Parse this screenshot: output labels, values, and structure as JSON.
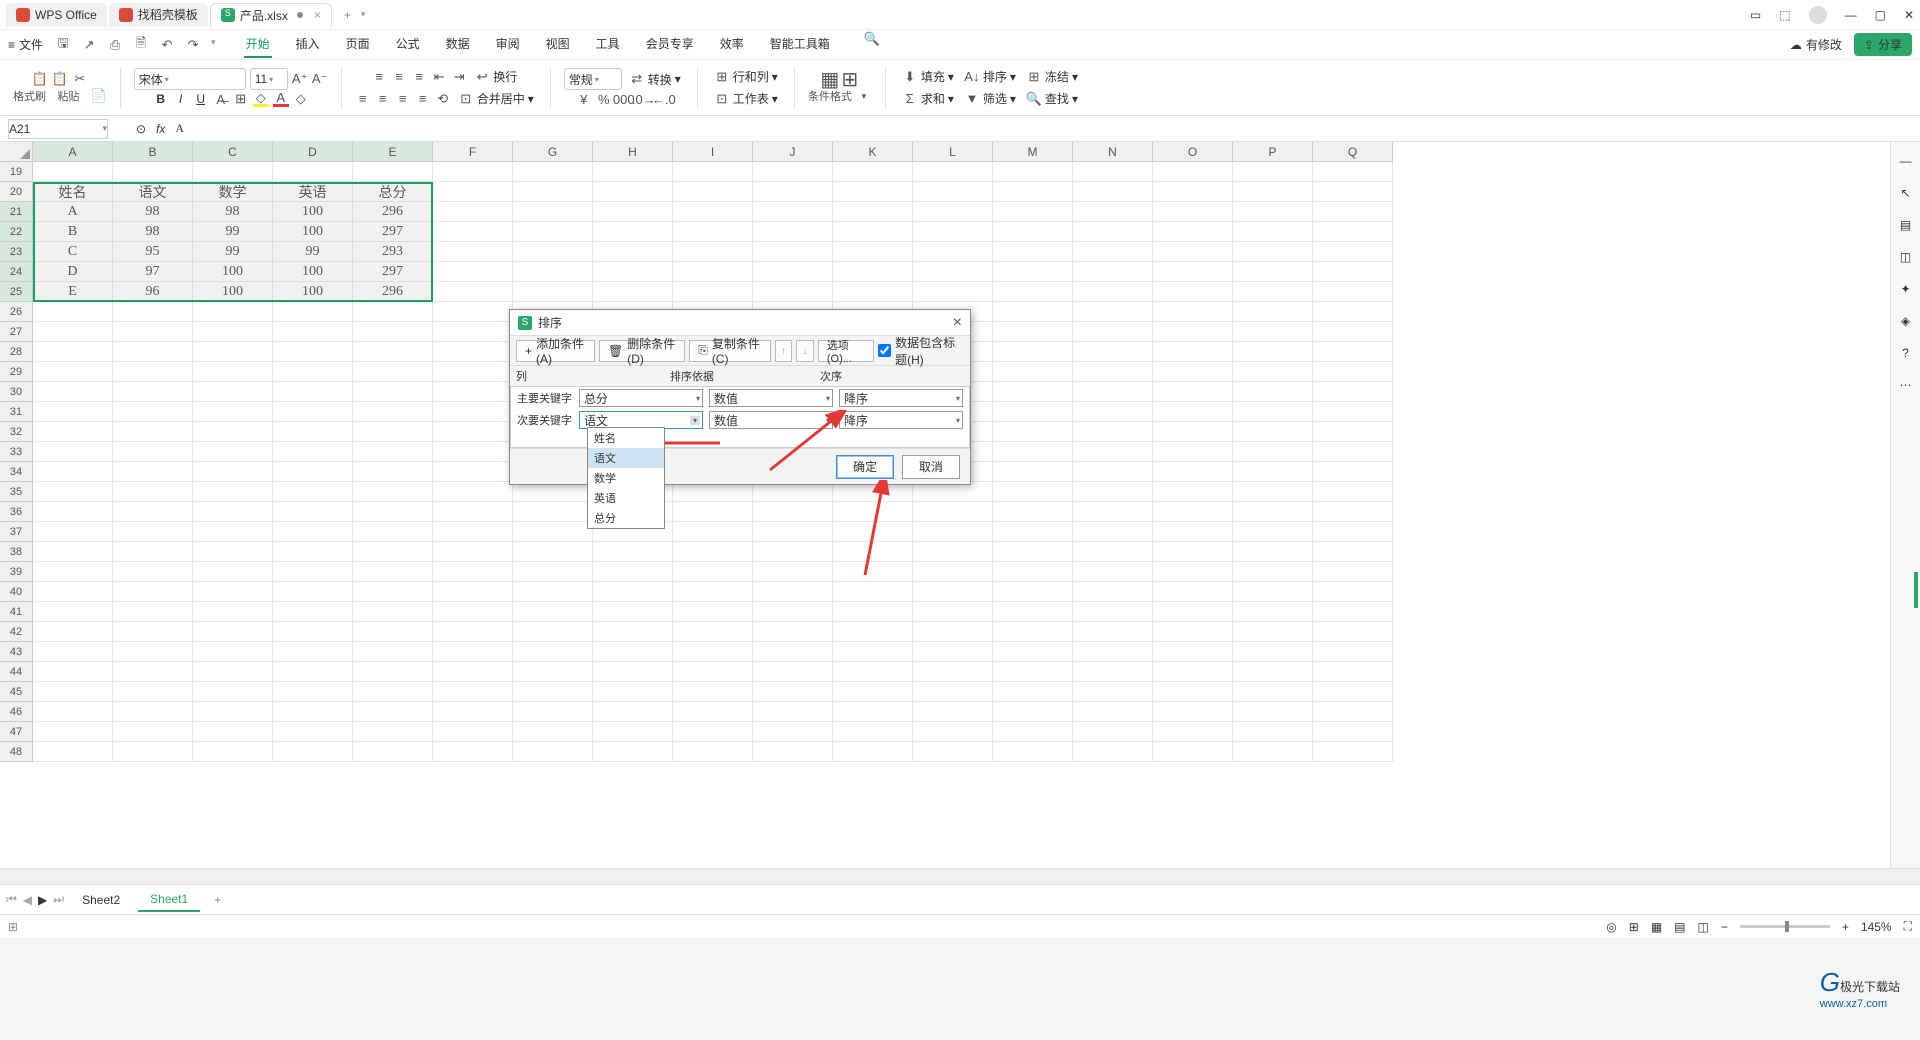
{
  "titlebar": {
    "tabs": [
      {
        "icon_color": "#d94b3a",
        "label": "WPS Office"
      },
      {
        "icon_color": "#d94b3a",
        "label": "找稻壳模板"
      },
      {
        "icon_color": "#2ba769",
        "label": "产品.xlsx",
        "dirty": true
      }
    ],
    "plus": "+"
  },
  "menubar": {
    "file": "文件",
    "menus": [
      "开始",
      "插入",
      "页面",
      "公式",
      "数据",
      "审阅",
      "视图",
      "工具",
      "会员专享",
      "效率",
      "智能工具箱"
    ],
    "active": 0,
    "right": {
      "saved": "有修改",
      "share": "分享"
    }
  },
  "ribbon": {
    "format_brush": "格式刷",
    "paste": "粘贴",
    "font_name": "宋体",
    "font_size": "11",
    "number_fmt": "常规",
    "convert": "转换",
    "row_col": "行和列",
    "worksheet": "工作表",
    "cond_fmt": "条件格式",
    "merge": "合并居中",
    "wrap": "换行",
    "fill": "填充",
    "sort": "排序",
    "freeze": "冻结",
    "sum": "求和",
    "filter": "筛选",
    "find": "查找"
  },
  "namebox": {
    "cell": "A21",
    "formula": "A"
  },
  "columns": [
    "A",
    "B",
    "C",
    "D",
    "E",
    "F",
    "G",
    "H",
    "I",
    "J",
    "K",
    "L",
    "M",
    "N",
    "O",
    "P",
    "Q"
  ],
  "sel_cols": 5,
  "rows_start": 19,
  "rows_count": 30,
  "sel_rows": [
    21,
    22,
    23,
    24,
    25
  ],
  "table": {
    "header": [
      "姓名",
      "语文",
      "数学",
      "英语",
      "总分"
    ],
    "data": [
      [
        "A",
        "98",
        "98",
        "100",
        "296"
      ],
      [
        "B",
        "98",
        "99",
        "100",
        "297"
      ],
      [
        "C",
        "95",
        "99",
        "99",
        "293"
      ],
      [
        "D",
        "97",
        "100",
        "100",
        "297"
      ],
      [
        "E",
        "96",
        "100",
        "100",
        "296"
      ]
    ]
  },
  "sheets": {
    "tabs": [
      "Sheet2",
      "Sheet1"
    ],
    "active": 1,
    "plus": "+"
  },
  "statusbar": {
    "zoom": "145%"
  },
  "dialog": {
    "title": "排序",
    "buttons": {
      "add": "添加条件(A)",
      "delete": "删除条件(D)",
      "copy": "复制条件(C)",
      "options": "选项(O)...",
      "header_chk": "数据包含标题(H)"
    },
    "hdr": {
      "col": "列",
      "basis": "排序依据",
      "order": "次序"
    },
    "row1": {
      "label": "主要关键字",
      "col": "总分",
      "basis": "数值",
      "order": "降序"
    },
    "row2": {
      "label": "次要关键字",
      "col": "语文",
      "basis": "数值",
      "order": "降序"
    },
    "dropdown": [
      "姓名",
      "语文",
      "数学",
      "英语",
      "总分"
    ],
    "dropdown_hover": 1,
    "ok": "确定",
    "cancel": "取消"
  },
  "watermark": {
    "main": "极光下载站",
    "sub": "www.xz7.com"
  },
  "chart_data": null
}
